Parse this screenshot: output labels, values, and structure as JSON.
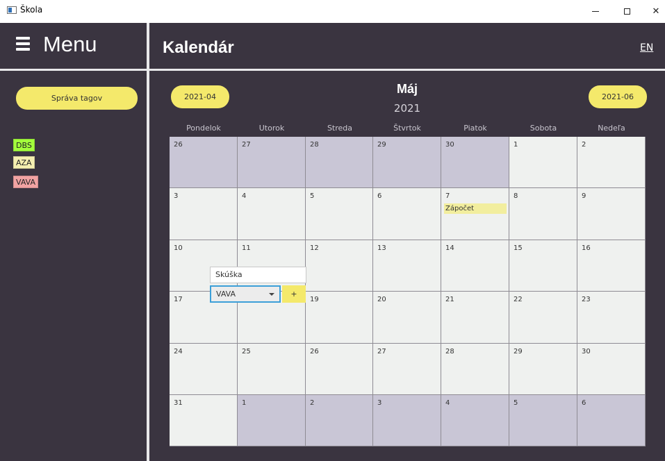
{
  "window": {
    "title": "Škola",
    "icon": "window-app-icon",
    "controls": [
      "minimize-icon",
      "maximize-icon",
      "close-icon"
    ],
    "close_glyph": "✕"
  },
  "sidebar": {
    "menu_label": "Menu",
    "menu_icon": "hamburger-icon",
    "manage_tags_label": "Správa tagov",
    "tags": [
      {
        "label": "DBS",
        "color": "#a3ff3c"
      },
      {
        "label": "AZA",
        "color": "#f4eeb0"
      },
      {
        "label": "VAVA",
        "color": "#f1a3a3"
      }
    ]
  },
  "header": {
    "title": "Kalendár",
    "language": "EN"
  },
  "calendar": {
    "prev_label": "2021-04",
    "next_label": "2021-06",
    "month": "Máj",
    "year": "2021",
    "weekdays": [
      "Pondelok",
      "Utorok",
      "Streda",
      "Štvrtok",
      "Piatok",
      "Sobota",
      "Nedeľa"
    ],
    "weeks": [
      [
        {
          "day": "26",
          "out": true
        },
        {
          "day": "27",
          "out": true
        },
        {
          "day": "28",
          "out": true
        },
        {
          "day": "29",
          "out": true
        },
        {
          "day": "30",
          "out": true
        },
        {
          "day": "1",
          "out": false
        },
        {
          "day": "2",
          "out": false
        }
      ],
      [
        {
          "day": "3",
          "out": false
        },
        {
          "day": "4",
          "out": false
        },
        {
          "day": "5",
          "out": false
        },
        {
          "day": "6",
          "out": false
        },
        {
          "day": "7",
          "out": false,
          "event": "Zápočet"
        },
        {
          "day": "8",
          "out": false
        },
        {
          "day": "9",
          "out": false
        }
      ],
      [
        {
          "day": "10",
          "out": false
        },
        {
          "day": "11",
          "out": false
        },
        {
          "day": "12",
          "out": false
        },
        {
          "day": "13",
          "out": false
        },
        {
          "day": "14",
          "out": false
        },
        {
          "day": "15",
          "out": false
        },
        {
          "day": "16",
          "out": false
        }
      ],
      [
        {
          "day": "17",
          "out": false
        },
        {
          "day": "18",
          "out": false
        },
        {
          "day": "19",
          "out": false
        },
        {
          "day": "20",
          "out": false
        },
        {
          "day": "21",
          "out": false
        },
        {
          "day": "22",
          "out": false
        },
        {
          "day": "23",
          "out": false
        }
      ],
      [
        {
          "day": "24",
          "out": false
        },
        {
          "day": "25",
          "out": false
        },
        {
          "day": "26",
          "out": false
        },
        {
          "day": "27",
          "out": false
        },
        {
          "day": "28",
          "out": false
        },
        {
          "day": "29",
          "out": false
        },
        {
          "day": "30",
          "out": false
        }
      ],
      [
        {
          "day": "31",
          "out": false
        },
        {
          "day": "1",
          "out": true
        },
        {
          "day": "2",
          "out": true
        },
        {
          "day": "3",
          "out": true
        },
        {
          "day": "4",
          "out": true
        },
        {
          "day": "5",
          "out": true
        },
        {
          "day": "6",
          "out": true
        }
      ]
    ]
  },
  "add_event_popup": {
    "input_value": "Skúška",
    "tag_select_value": "VAVA",
    "add_label": "+"
  },
  "colors": {
    "accent": "#f4e96b",
    "background": "#3a3440",
    "outside_day": "#c9c6d6",
    "inside_day": "#eff1ef"
  }
}
